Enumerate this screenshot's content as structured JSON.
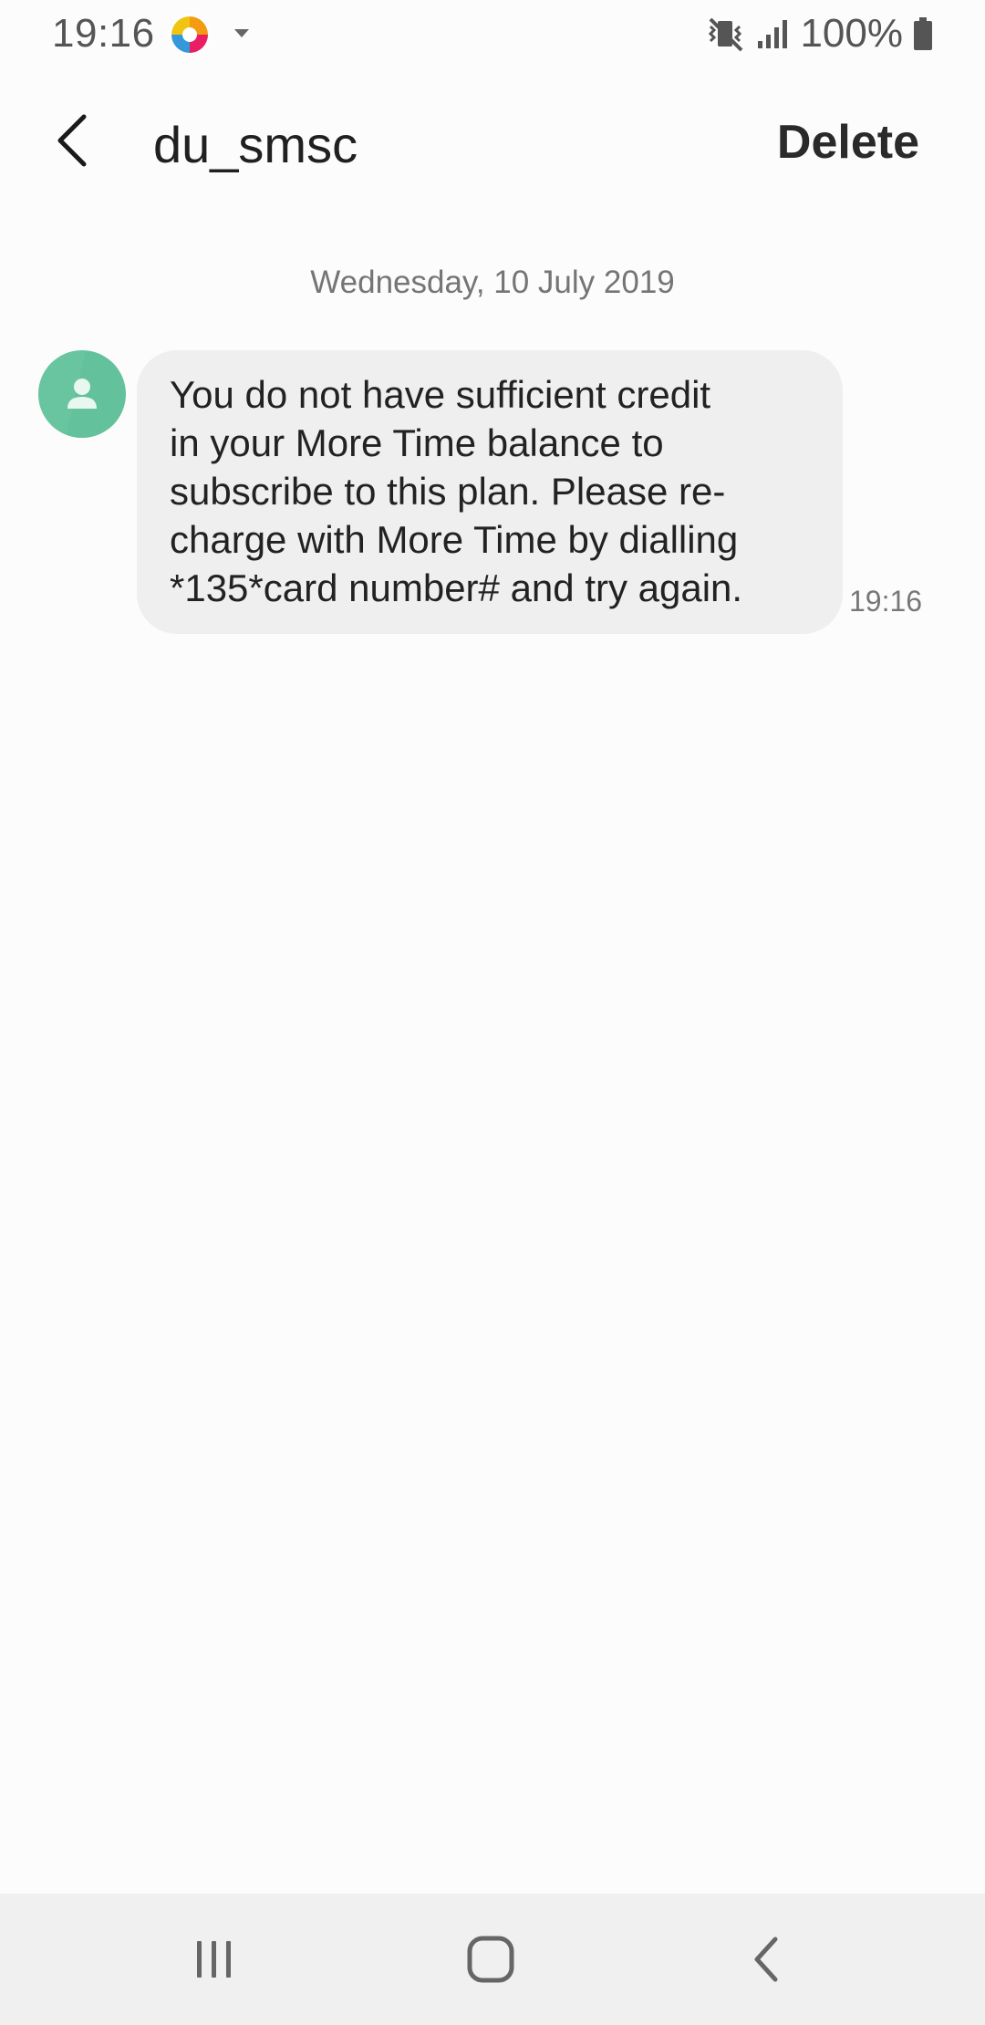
{
  "status_bar": {
    "time": "19:16",
    "battery": "100%",
    "icons": [
      "app-notification-icon",
      "dropdown-arrow-icon",
      "vibrate-icon",
      "signal-icon",
      "battery-icon"
    ]
  },
  "header": {
    "contact_name": "du_smsc",
    "delete_label": "Delete",
    "back_icon": "back-arrow-icon"
  },
  "conversation": {
    "date": "Wednesday, 10 July 2019",
    "messages": [
      {
        "lines": [
          "You do not have sufficient credit",
          "in your More Time balance to",
          "subscribe to this plan. Please re-",
          "charge with More Time by dialling",
          "*135*card number# and try again."
        ],
        "time": "19:16",
        "avatar_icon": "person-icon"
      }
    ]
  },
  "nav_bar": {
    "icons": [
      "recent-apps-icon",
      "home-icon",
      "back-icon"
    ]
  },
  "colors": {
    "avatar": "#63c19b",
    "bubble": "#efefef",
    "background": "#fcfcfc",
    "nav_bar": "#f0f0f0"
  }
}
